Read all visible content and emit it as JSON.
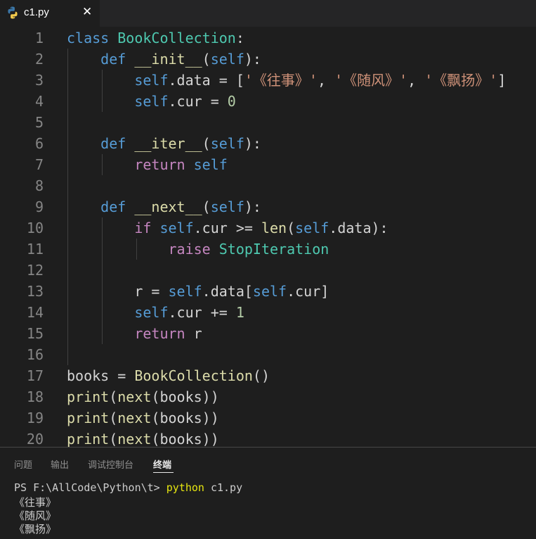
{
  "tab": {
    "title": "c1.py",
    "close": "✕",
    "icon": "python-file-icon"
  },
  "editor": {
    "line_numbers": [
      "1",
      "2",
      "3",
      "4",
      "5",
      "6",
      "7",
      "8",
      "9",
      "10",
      "11",
      "12",
      "13",
      "14",
      "15",
      "16",
      "17",
      "18",
      "19",
      "20"
    ],
    "lines": [
      [
        [
          "kw",
          "class "
        ],
        [
          "cls",
          "BookCollection"
        ],
        [
          "",
          ""
        ],
        [
          "",
          ":"
        ]
      ],
      [
        [
          "",
          "    "
        ],
        [
          "kw",
          "def "
        ],
        [
          "fn",
          "__init__"
        ],
        [
          "",
          "("
        ],
        [
          "kw",
          "self"
        ],
        [
          "",
          "):"
        ]
      ],
      [
        [
          "",
          "        "
        ],
        [
          "kw",
          "self"
        ],
        [
          "",
          ".data = ["
        ],
        [
          "str",
          "'《往事》'"
        ],
        [
          "",
          ", "
        ],
        [
          "str",
          "'《随风》'"
        ],
        [
          "",
          ", "
        ],
        [
          "str",
          "'《飘扬》'"
        ],
        [
          "",
          "]"
        ]
      ],
      [
        [
          "",
          "        "
        ],
        [
          "kw",
          "self"
        ],
        [
          "",
          ".cur = "
        ],
        [
          "num",
          "0"
        ]
      ],
      [],
      [
        [
          "",
          "    "
        ],
        [
          "kw",
          "def "
        ],
        [
          "fn",
          "__iter__"
        ],
        [
          "",
          "("
        ],
        [
          "kw",
          "self"
        ],
        [
          "",
          "):"
        ]
      ],
      [
        [
          "",
          "        "
        ],
        [
          "ctl",
          "return "
        ],
        [
          "kw",
          "self"
        ]
      ],
      [],
      [
        [
          "",
          "    "
        ],
        [
          "kw",
          "def "
        ],
        [
          "fn",
          "__next__"
        ],
        [
          "",
          "("
        ],
        [
          "kw",
          "self"
        ],
        [
          "",
          "):"
        ]
      ],
      [
        [
          "",
          "        "
        ],
        [
          "ctl",
          "if "
        ],
        [
          "kw",
          "self"
        ],
        [
          "",
          ".cur >= "
        ],
        [
          "fn",
          "len"
        ],
        [
          "",
          "("
        ],
        [
          "kw",
          "self"
        ],
        [
          "",
          ".data):"
        ]
      ],
      [
        [
          "",
          "            "
        ],
        [
          "ctl",
          "raise "
        ],
        [
          "cls",
          "StopIteration"
        ]
      ],
      [],
      [
        [
          "",
          "        r = "
        ],
        [
          "kw",
          "self"
        ],
        [
          "",
          ".data["
        ],
        [
          "kw",
          "self"
        ],
        [
          "",
          ".cur]"
        ]
      ],
      [
        [
          "",
          "        "
        ],
        [
          "kw",
          "self"
        ],
        [
          "",
          ".cur += "
        ],
        [
          "num",
          "1"
        ]
      ],
      [
        [
          "",
          "        "
        ],
        [
          "ctl",
          "return "
        ],
        [
          "",
          "r"
        ]
      ],
      [],
      [
        [
          "",
          "books = "
        ],
        [
          "fn",
          "BookCollection"
        ],
        [
          "",
          "()"
        ]
      ],
      [
        [
          "fn",
          "print"
        ],
        [
          "",
          "("
        ],
        [
          "fn",
          "next"
        ],
        [
          "",
          "(books))"
        ]
      ],
      [
        [
          "fn",
          "print"
        ],
        [
          "",
          "("
        ],
        [
          "fn",
          "next"
        ],
        [
          "",
          "(books))"
        ]
      ],
      [
        [
          "fn",
          "print"
        ],
        [
          "",
          "("
        ],
        [
          "fn",
          "next"
        ],
        [
          "",
          "(books))"
        ]
      ]
    ]
  },
  "panel": {
    "tabs": [
      "问题",
      "输出",
      "调试控制台",
      "终端"
    ],
    "active_tab": "终端",
    "terminal": {
      "prompt": "PS F:\\AllCode\\Python\\t> ",
      "command": "python",
      "args": " c1.py",
      "output": [
        "《往事》",
        "《随风》",
        "《飘扬》"
      ]
    }
  }
}
